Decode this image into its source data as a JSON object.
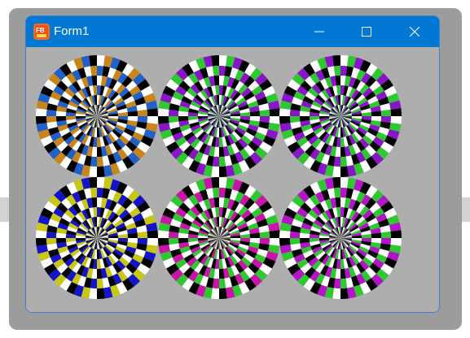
{
  "window": {
    "title": "Form1",
    "icon": "freebasic-app-icon",
    "controls": [
      "minimize-icon",
      "maximize-icon",
      "close-icon"
    ]
  },
  "colors": {
    "titlebar": "#0078d4",
    "client_background": "#aeaeae",
    "white": "#ffffff",
    "black": "#000000"
  },
  "wheels": [
    {
      "name": "wheel-orange-blue",
      "colors": [
        "#ffffff",
        "#c8861a",
        "#2060c8",
        "#000000"
      ]
    },
    {
      "name": "wheel-green-purple-1",
      "colors": [
        "#ffffff",
        "#30c830",
        "#8a14c8",
        "#000000"
      ]
    },
    {
      "name": "wheel-green-purple-2",
      "colors": [
        "#ffffff",
        "#30c830",
        "#8a14c8",
        "#000000"
      ]
    },
    {
      "name": "wheel-yellow-blue",
      "colors": [
        "#ffffff",
        "#c8c814",
        "#1414c8",
        "#000000"
      ]
    },
    {
      "name": "wheel-green-magenta",
      "colors": [
        "#ffffff",
        "#30c830",
        "#c814a8",
        "#000000"
      ]
    },
    {
      "name": "wheel-green-purple-3",
      "colors": [
        "#ffffff",
        "#30c830",
        "#b414c8",
        "#000000"
      ]
    }
  ]
}
